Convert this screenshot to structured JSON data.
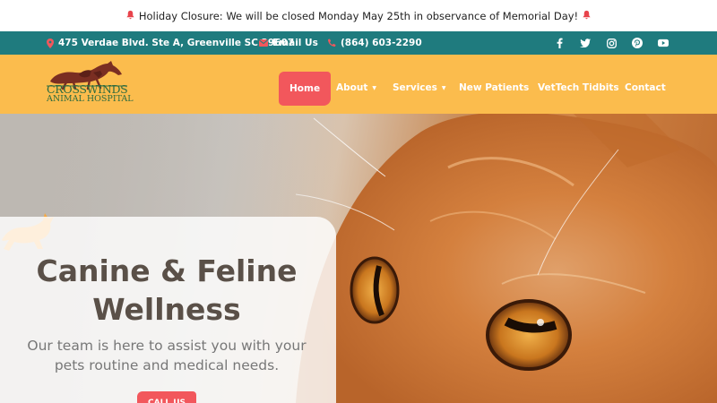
{
  "alert": {
    "text": "Holiday Closure: We will be closed Monday May 25th in observance of Memorial Day!",
    "icon": "bell-icon"
  },
  "contact": {
    "address": "475 Verdae Blvd. Ste A, Greenville SC 29607",
    "email_label": "Email Us",
    "phone": "(864) 603-2290",
    "social": [
      "facebook-icon",
      "twitter-icon",
      "instagram-icon",
      "pinterest-icon",
      "youtube-icon"
    ]
  },
  "brand": {
    "name_line1": "CROSSWINDS",
    "name_line2": "ANIMAL HOSPITAL"
  },
  "nav": {
    "home": "Home",
    "about": "About",
    "services": "Services",
    "new_patients": "New Patients",
    "vettech": "VetTech Tidbits",
    "contact": "Contact"
  },
  "hero": {
    "title_line1": "Canine & Feline",
    "title_line2": "Wellness",
    "text_line1": "Our team is here to assist you with your",
    "text_line2": "pets routine and medical needs.",
    "button": "CALL US"
  },
  "colors": {
    "teal": "#1f7b7e",
    "yellow": "#fbbc4d",
    "coral": "#f2575c"
  }
}
